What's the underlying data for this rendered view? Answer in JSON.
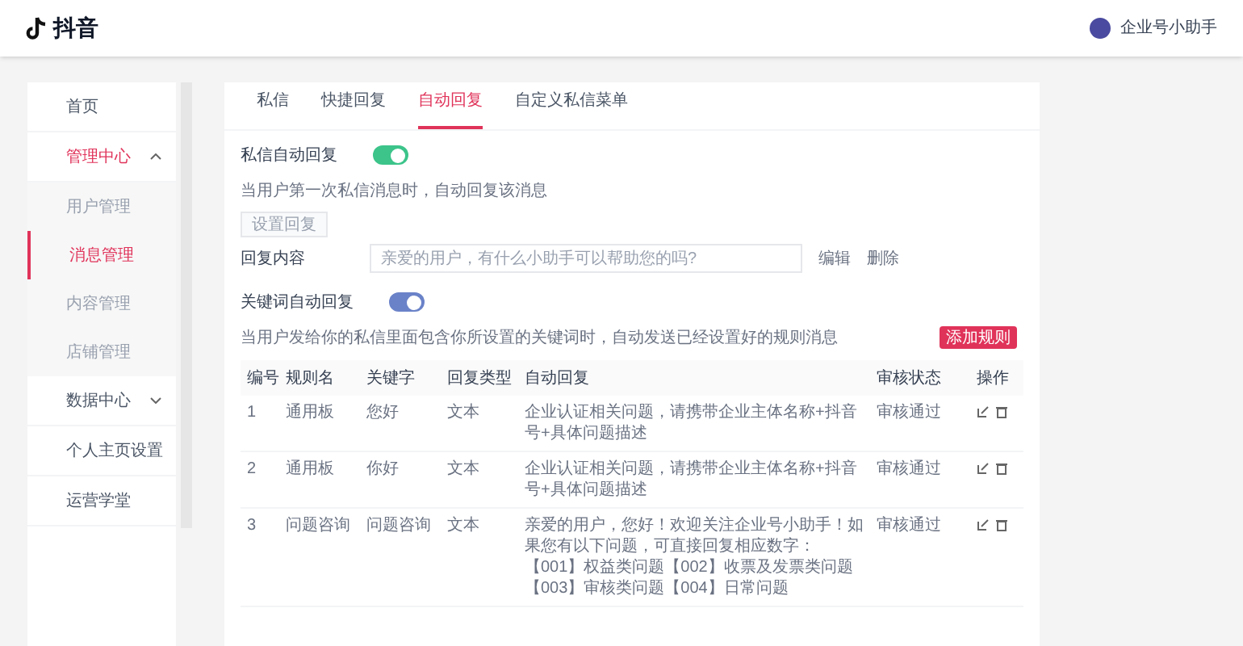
{
  "header": {
    "brand": "抖音",
    "account": "企业号小助手"
  },
  "sidebar": {
    "items": [
      {
        "label": "首页",
        "kind": "item",
        "selected": false
      },
      {
        "label": "管理中心",
        "kind": "group",
        "expanded": true,
        "children": [
          {
            "label": "用户管理",
            "selected": false
          },
          {
            "label": "消息管理",
            "selected": true
          },
          {
            "label": "内容管理",
            "selected": false
          },
          {
            "label": "店铺管理",
            "selected": false
          }
        ]
      },
      {
        "label": "数据中心",
        "kind": "group",
        "expanded": false
      },
      {
        "label": "个人主页设置",
        "kind": "item",
        "selected": false
      },
      {
        "label": "运营学堂",
        "kind": "item",
        "selected": false
      }
    ]
  },
  "tabs": [
    {
      "label": "私信",
      "selected": false
    },
    {
      "label": "快捷回复",
      "selected": false
    },
    {
      "label": "自动回复",
      "selected": true
    },
    {
      "label": "自定义私信菜单",
      "selected": false
    }
  ],
  "auto_reply": {
    "label": "私信自动回复",
    "on": true,
    "description": "当用户第一次私信消息时，自动回复该消息",
    "button": "设置回复",
    "content_label": "回复内容",
    "content_value": "亲爱的用户，有什么小助手可以帮助您的吗?",
    "actions": [
      "编辑",
      "删除"
    ]
  },
  "keyword_reply": {
    "label": "关键词自动回复",
    "on": true,
    "description": "当用户发给你的私信里面包含你所设置的关键词时，自动发送已经设置好的规则消息",
    "button": "添加规则"
  },
  "table": {
    "columns": [
      "编号",
      "规则名",
      "关键字",
      "回复类型",
      "自动回复",
      "审核状态",
      "操作"
    ],
    "rows": [
      [
        "1",
        "通用板",
        "您好",
        "文本",
        "企业认证相关问题，请携带企业主体名称+抖音号+具体问题描述",
        "审核通过"
      ],
      [
        "2",
        "通用板",
        "你好",
        "文本",
        "企业认证相关问题，请携带企业主体名称+抖音号+具体问题描述",
        "审核通过"
      ],
      [
        "3",
        "问题咨询",
        "问题咨询",
        "文本",
        "亲爱的用户，您好！欢迎关注企业号小助手！如果您有以下问题，可直接回复相应数字：【001】权益类问题【002】收票及发票类问题【003】审核类问题【004】日常问题",
        "审核通过"
      ]
    ]
  }
}
